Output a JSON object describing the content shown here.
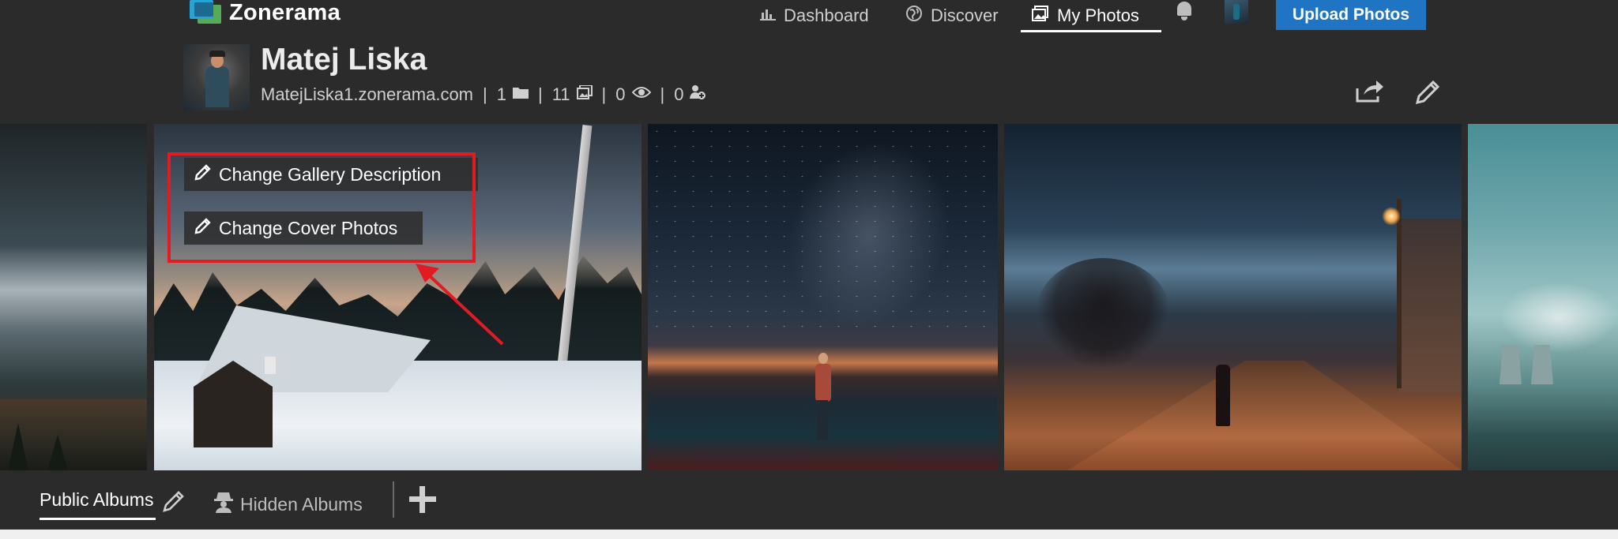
{
  "brand": {
    "name": "Zonerama"
  },
  "nav": {
    "dashboard": "Dashboard",
    "discover": "Discover",
    "my_photos": "My Photos",
    "upload": "Upload Photos"
  },
  "profile": {
    "name": "Matej Liska",
    "url": "MatejLiska1.zonerama.com",
    "albums_count": "1",
    "photos_count": "11",
    "views_count": "0",
    "followers_count": "0"
  },
  "gallery": {
    "change_description": "Change Gallery Description",
    "change_cover": "Change Cover Photos"
  },
  "tabs": {
    "public_albums": "Public Albums",
    "hidden_albums": "Hidden Albums"
  },
  "colors": {
    "accent": "#1f75c4",
    "highlight": "#e01b24",
    "background": "#2b2b2b"
  }
}
